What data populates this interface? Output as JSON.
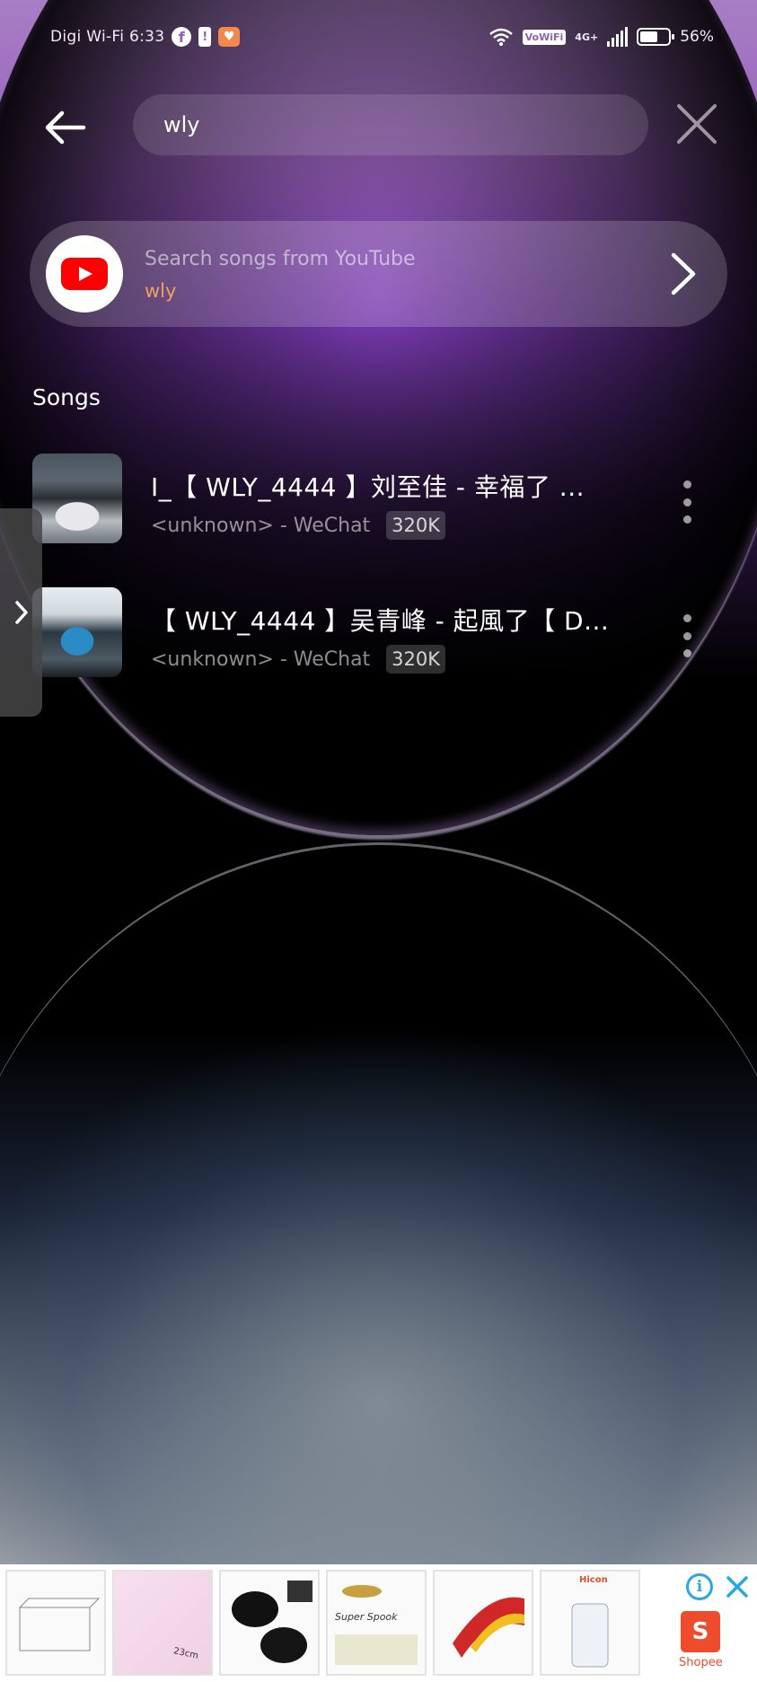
{
  "status_bar": {
    "carrier_time": "Digi Wi-Fi 6:33",
    "vowifi": "VoWiFi",
    "network": "4G+",
    "battery": "56%"
  },
  "search": {
    "query": "wly"
  },
  "youtube_card": {
    "title": "Search songs from YouTube",
    "query": "wly"
  },
  "section_title": "Songs",
  "songs": [
    {
      "title": "I_【 WLY_4444 】刘至佳 - 幸福了 ...",
      "subtitle": "<unknown> - WeChat",
      "quality": "320K"
    },
    {
      "title": "【 WLY_4444 】吴青峰 - 起風了【 D...",
      "subtitle": "<unknown> - WeChat",
      "quality": "320K"
    }
  ],
  "ad": {
    "items": [
      "",
      "23cm",
      "",
      "Super Spook",
      "",
      "Hicon"
    ],
    "brand": "Shopee"
  },
  "colors": {
    "accent_query": "#f0a060",
    "youtube_red": "#ff0000",
    "shopee": "#ee4d2d"
  }
}
